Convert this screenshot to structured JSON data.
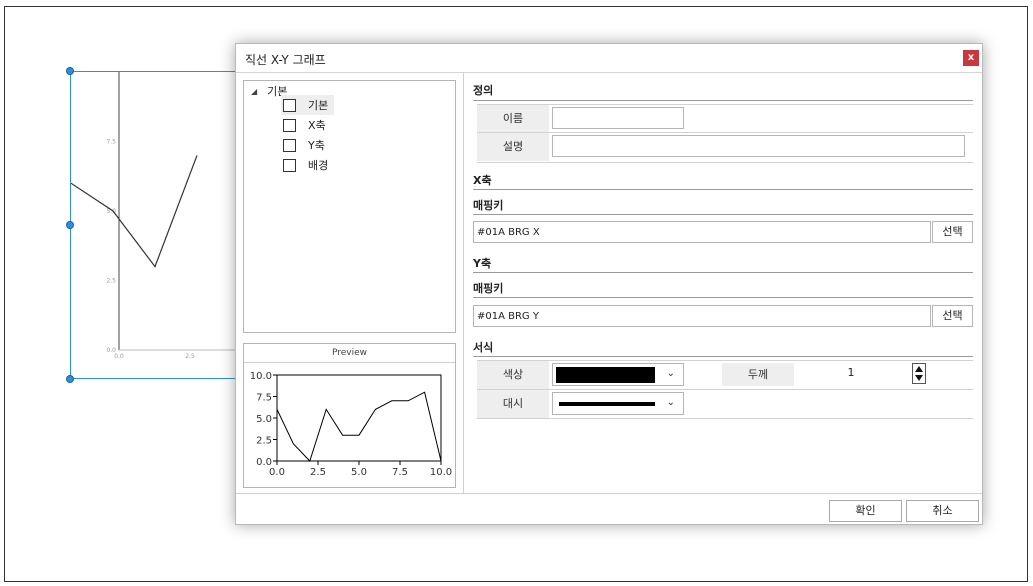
{
  "background_chart": {
    "y_ticks": [
      "7.5",
      "5.0",
      "2.5",
      "0.0"
    ],
    "x_ticks": [
      "0.0",
      "2.5"
    ],
    "line_values": [
      [
        0,
        6
      ],
      [
        1,
        5
      ],
      [
        2,
        3
      ],
      [
        3,
        7
      ]
    ]
  },
  "dialog": {
    "title": "직선 X-Y 그래프",
    "close_label": "x",
    "tree": {
      "root_label": "기본",
      "items": [
        {
          "label": "기본"
        },
        {
          "label": "X축"
        },
        {
          "label": "Y축"
        },
        {
          "label": "배경"
        }
      ]
    },
    "preview": {
      "header": "Preview"
    },
    "sections": {
      "definition": "정의",
      "x_axis": "X축",
      "y_axis": "Y축",
      "format": "서식"
    },
    "fields": {
      "name_label": "이름",
      "name_value": "",
      "desc_label": "설명",
      "desc_value": "",
      "x_mapping_title": "매핑키",
      "x_mapping_value": "#01A BRG X",
      "y_mapping_title": "매핑키",
      "y_mapping_value": "#01A BRG Y",
      "select_label": "선택",
      "color_label": "색상",
      "color_value": "#000000",
      "thickness_label": "두께",
      "thickness_value": "1",
      "dash_label": "대시"
    },
    "buttons": {
      "ok": "확인",
      "cancel": "취소"
    }
  },
  "chart_data": {
    "type": "line",
    "title": "",
    "xlabel": "",
    "ylabel": "",
    "x": [
      0,
      1,
      2,
      3,
      4,
      5,
      6,
      7,
      8,
      9,
      10
    ],
    "series": [
      {
        "values": [
          6,
          2,
          0,
          6,
          3,
          3,
          6,
          7,
          7,
          8,
          0
        ]
      }
    ],
    "xlim": [
      0,
      10
    ],
    "ylim": [
      0,
      10
    ],
    "x_ticks": [
      "0.0",
      "2.5",
      "5.0",
      "7.5",
      "10.0"
    ],
    "y_ticks": [
      "0.0",
      "2.5",
      "5.0",
      "7.5",
      "10.0"
    ],
    "grid": false
  }
}
